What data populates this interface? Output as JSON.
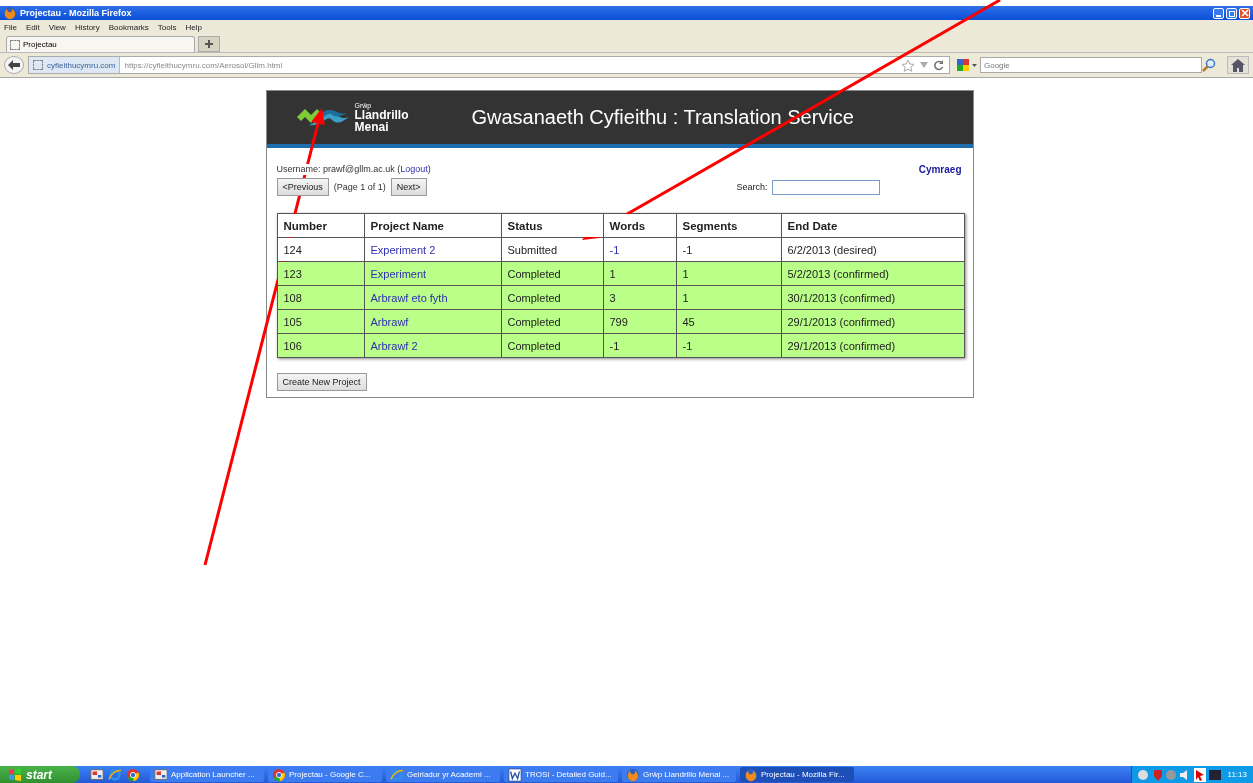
{
  "window": {
    "title": "Projectau - Mozilla Firefox"
  },
  "menu": [
    "File",
    "Edit",
    "View",
    "History",
    "Bookmarks",
    "Tools",
    "Help"
  ],
  "tabs": [
    {
      "label": "Projectau",
      "selected": true
    }
  ],
  "address_bar": {
    "identity": "cyfieithucymru.com",
    "url": "https://cyfieithucymru.com/Aerosol/Gllm.html"
  },
  "search_bar": {
    "placeholder": "Google"
  },
  "page": {
    "logo": {
      "small": "Grŵp",
      "line1": "Llandrillo",
      "line2": "Menai"
    },
    "title": "Gwasanaeth Cyfieithu : Translation Service",
    "user": {
      "before": "Username: prawf@gllm.ac.uk (",
      "link": "Logout",
      "after": ")"
    },
    "language_link": "Cymraeg",
    "pager": {
      "previous": "<Previous",
      "info": "(Page 1 of 1)",
      "next": "Next>"
    },
    "search_label": "Search:",
    "table": {
      "columns": [
        "Number",
        "Project Name",
        "Status",
        "Words",
        "Segments",
        "End Date"
      ],
      "rows": [
        {
          "number": "124",
          "name": "Experiment 2",
          "status": "Submitted",
          "words": "-1",
          "segments": "-1",
          "end_date": "6/2/2013 (desired)",
          "highlighted": false
        },
        {
          "number": "123",
          "name": "Experiment",
          "status": "Completed",
          "words": "1",
          "segments": "1",
          "end_date": "5/2/2013 (confirmed)",
          "highlighted": true
        },
        {
          "number": "108",
          "name": "Arbrawf eto fyth",
          "status": "Completed",
          "words": "3",
          "segments": "1",
          "end_date": "30/1/2013 (confirmed)",
          "highlighted": true
        },
        {
          "number": "105",
          "name": "Arbrawf",
          "status": "Completed",
          "words": "799",
          "segments": "45",
          "end_date": "29/1/2013 (confirmed)",
          "highlighted": true
        },
        {
          "number": "106",
          "name": "Arbrawf 2",
          "status": "Completed",
          "words": "-1",
          "segments": "-1",
          "end_date": "29/1/2013 (confirmed)",
          "highlighted": true
        }
      ]
    },
    "create_button": "Create New Project"
  },
  "annotations": [
    {
      "kind": "arrow",
      "color": "#ff0000"
    },
    {
      "kind": "arrow",
      "color": "#ff0000"
    }
  ],
  "taskbar": {
    "start": "start",
    "tasks": [
      {
        "label": "Application Launcher ...",
        "selected": false
      },
      {
        "label": "Projectau - Google C...",
        "selected": false
      },
      {
        "label": "Geiriadur yr Academi ...",
        "selected": false
      },
      {
        "label": "TROSI - Detailed Guid...",
        "selected": false
      },
      {
        "label": "Grŵp Llandrillo Menai ...",
        "selected": false
      },
      {
        "label": "Projectau - Mozilla Fir...",
        "selected": true
      }
    ],
    "time": "11:13"
  }
}
